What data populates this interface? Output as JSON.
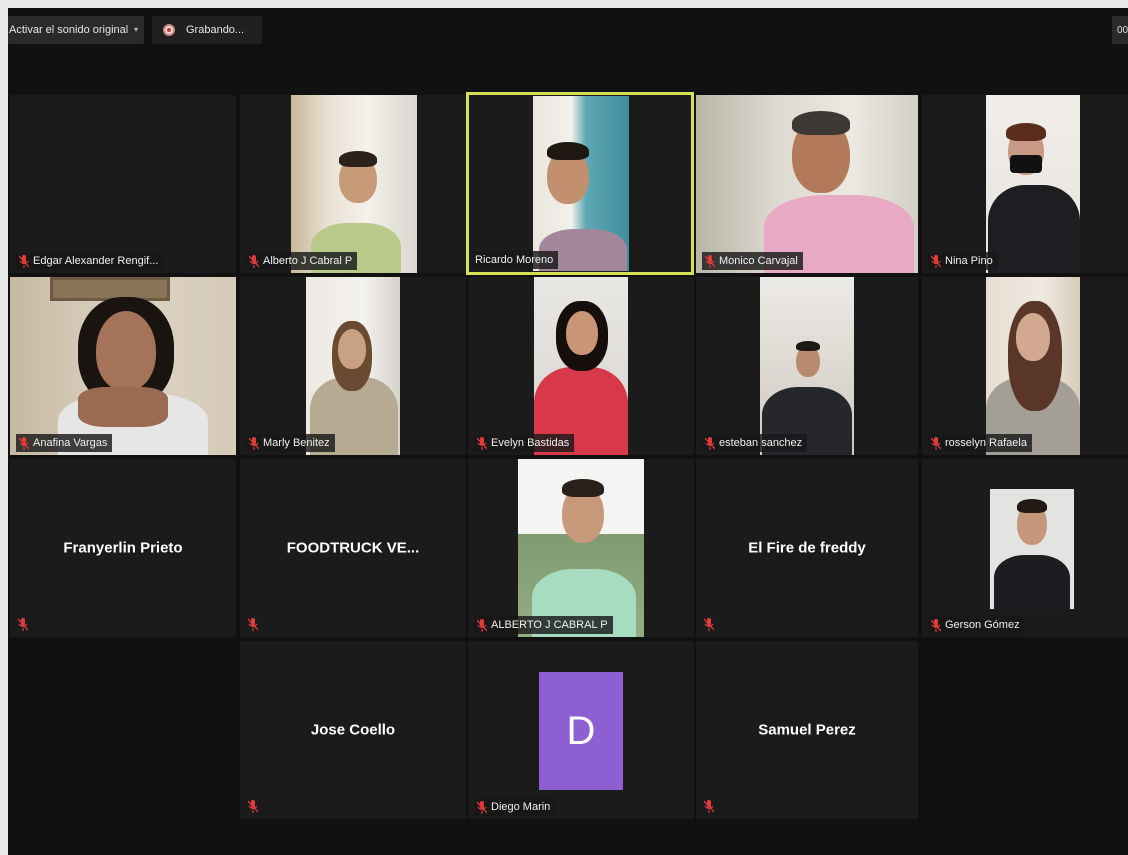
{
  "toolbar": {
    "audio_label": "Activar el sonido original",
    "audio_caret": "▾",
    "recording_label": "Grabando...",
    "timer": "00"
  },
  "participants": [
    {
      "name": "Edgar Alexander Rengif...",
      "muted": true,
      "video": false
    },
    {
      "name": "Alberto J Cabral P",
      "muted": true,
      "video": true
    },
    {
      "name": "Ricardo Moreno",
      "muted": false,
      "video": true,
      "active_speaker": true
    },
    {
      "name": "Monico Carvajal",
      "muted": true,
      "video": true
    },
    {
      "name": "Nina Pino",
      "muted": true,
      "video": true
    },
    {
      "name": "Anafina Vargas",
      "muted": true,
      "video": true
    },
    {
      "name": "Marly Benitez",
      "muted": true,
      "video": true
    },
    {
      "name": "Evelyn Bastidas",
      "muted": true,
      "video": true
    },
    {
      "name": "esteban sanchez",
      "muted": true,
      "video": true
    },
    {
      "name": "rosselyn Rafaela",
      "muted": true,
      "video": true
    },
    {
      "name": "Franyerlin Prieto",
      "muted": true,
      "video": false
    },
    {
      "name": "FOODTRUCK  VE...",
      "muted": true,
      "video": false
    },
    {
      "name": "ALBERTO J CABRAL P",
      "muted": true,
      "video": true
    },
    {
      "name": "El Fire de freddy",
      "muted": true,
      "video": false
    },
    {
      "name": "Gerson Gómez",
      "muted": true,
      "video": true
    },
    {
      "name": "Jose Coello",
      "muted": true,
      "video": false
    },
    {
      "name": "Diego Marin",
      "muted": true,
      "video": false,
      "avatar_letter": "D"
    },
    {
      "name": "Samuel Perez",
      "muted": true,
      "video": false
    }
  ],
  "colors": {
    "active_speaker_border": "#d4e157",
    "muted_icon": "#e03b3b",
    "avatar_bg": "#8e5fd2",
    "tile_bg": "#1b1b1b",
    "app_bg": "#111111"
  },
  "icons": {
    "muted": "mic-off-icon",
    "recording": "record-dot-icon",
    "dropdown": "chevron-down-icon"
  }
}
